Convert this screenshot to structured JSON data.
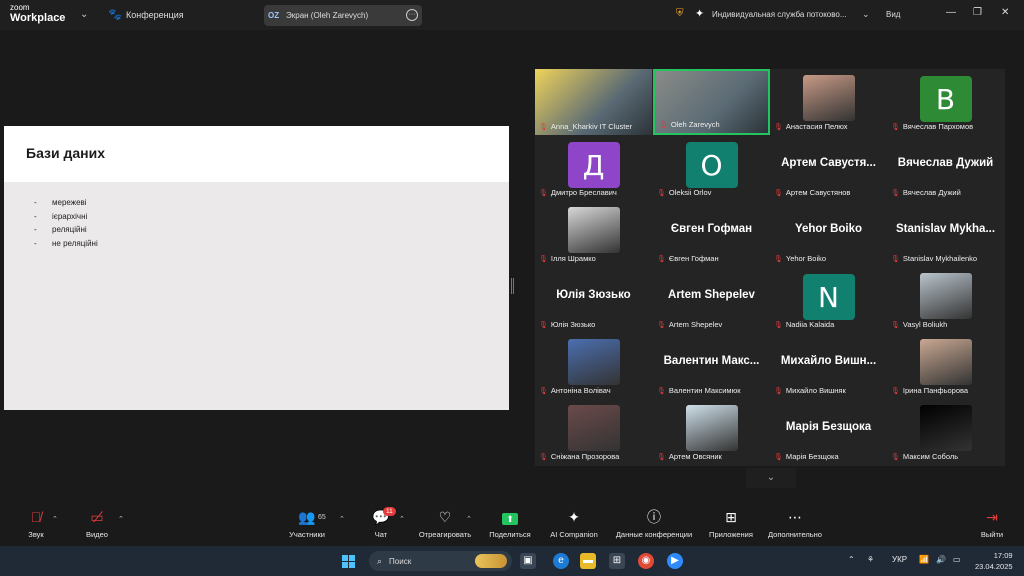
{
  "titlebar": {
    "logo_line1": "zoom",
    "logo_line2": "Workplace",
    "meeting_label": "Конференция",
    "share_initials": "OZ",
    "share_title": "Экран (Oleh Zarevych)",
    "stream_label": "Индивидуальная служба потоково...",
    "view_label": "Вид"
  },
  "slide": {
    "title": "Бази даних",
    "bullets": [
      "мережеві",
      "ієрархічні",
      "реляційні",
      "не реляційні"
    ],
    "bullet_marker": "-"
  },
  "tiles": [
    {
      "name": "Anna_Kharkiv IT Cluster",
      "kind": "video",
      "color": "#f0d35a"
    },
    {
      "name": "Oleh Zarevych",
      "kind": "video",
      "color": "#8a8c88",
      "active": true
    },
    {
      "name": "Анастасия Пелюх",
      "kind": "photo",
      "color": "#c89a86"
    },
    {
      "name": "Вячеслав Пархомов",
      "kind": "letter",
      "letter": "В",
      "color": "#2f8a35"
    },
    {
      "name": "Дмитро Бреславич",
      "kind": "letter",
      "letter": "Д",
      "color": "#8e45c7"
    },
    {
      "name": "Oleksii Orlov",
      "kind": "letter",
      "letter": "O",
      "color": "#12806f"
    },
    {
      "name": "Артем Савустянов",
      "kind": "text",
      "big": "Артем  Савустя..."
    },
    {
      "name": "Вячеслав Дужий",
      "kind": "text",
      "big": "Вячеслав Дужий"
    },
    {
      "name": "Ілля Шрамко",
      "kind": "photo",
      "color": "#d8d8d8"
    },
    {
      "name": "Євген Гофман",
      "kind": "text",
      "big": "Євген Гофман"
    },
    {
      "name": "Yehor Boiko",
      "kind": "text",
      "big": "Yehor Boiko"
    },
    {
      "name": "Stanislav Mykhailenko",
      "kind": "text",
      "big": "Stanislav  Mykha..."
    },
    {
      "name": "Юлія Зюзько",
      "kind": "text",
      "big": "Юлія Зюзько"
    },
    {
      "name": "Artem Shepelev",
      "kind": "text",
      "big": "Artem Shepelev"
    },
    {
      "name": "Nadiia Kalaida",
      "kind": "letter",
      "letter": "N",
      "color": "#12806f"
    },
    {
      "name": "Vasyl Boliukh",
      "kind": "photo",
      "color": "#b9c4cc"
    },
    {
      "name": "Антоніна Волівач",
      "kind": "photo",
      "color": "#4b6fb0"
    },
    {
      "name": "Валентин Максимюк",
      "kind": "text",
      "big": "Валентин  Макс..."
    },
    {
      "name": "Михайло Вишняк",
      "kind": "text",
      "big": "Михайло  Вишн..."
    },
    {
      "name": "Ірина Панфьорова",
      "kind": "photo",
      "color": "#c9a892"
    },
    {
      "name": "Сніжана Прозорова",
      "kind": "photo",
      "color": "#6b4a4a"
    },
    {
      "name": "Артем Овсяник",
      "kind": "photo",
      "color": "#cfe0ea"
    },
    {
      "name": "Марія Безщока",
      "kind": "text",
      "big": "Марія Безщока"
    },
    {
      "name": "Максим Соболь",
      "kind": "photo",
      "color": "#000000"
    }
  ],
  "toolbar": {
    "audio_label": "Звук",
    "video_label": "Видео",
    "participants_label": "Участники",
    "participants_count": "65",
    "chat_label": "Чат",
    "chat_badge": "11",
    "react_label": "Отреагировать",
    "share_label": "Поделиться",
    "ai_label": "AI Companion",
    "info_label": "Данные конференции",
    "apps_label": "Приложения",
    "more_label": "Дополнительно",
    "leave_label": "Выйти"
  },
  "taskbar": {
    "search_placeholder": "Поиск",
    "lang": "УКР",
    "time": "17:09",
    "date": "23.04.2025"
  }
}
